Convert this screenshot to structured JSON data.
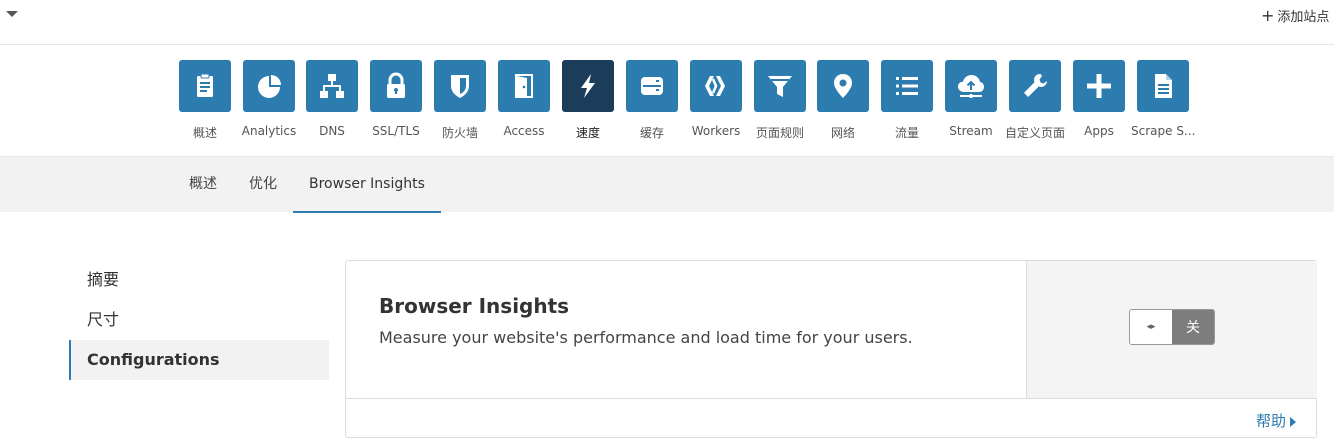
{
  "topbar": {
    "add_site_label": "添加站点"
  },
  "apps": [
    {
      "label": "概述",
      "icon": "clipboard-icon"
    },
    {
      "label": "Analytics",
      "icon": "pie-chart-icon"
    },
    {
      "label": "DNS",
      "icon": "network-icon"
    },
    {
      "label": "SSL/TLS",
      "icon": "lock-icon"
    },
    {
      "label": "防火墙",
      "icon": "shield-icon"
    },
    {
      "label": "Access",
      "icon": "door-icon"
    },
    {
      "label": "速度",
      "icon": "lightning-icon",
      "active": true
    },
    {
      "label": "缓存",
      "icon": "storage-icon"
    },
    {
      "label": "Workers",
      "icon": "workers-icon"
    },
    {
      "label": "页面规则",
      "icon": "filter-icon"
    },
    {
      "label": "网络",
      "icon": "location-pin-icon"
    },
    {
      "label": "流量",
      "icon": "list-icon"
    },
    {
      "label": "Stream",
      "icon": "cloud-upload-icon"
    },
    {
      "label": "自定义页面",
      "icon": "wrench-icon"
    },
    {
      "label": "Apps",
      "icon": "plus-icon"
    },
    {
      "label": "Scrape S...",
      "icon": "document-icon"
    }
  ],
  "subnav": {
    "tabs": [
      "概述",
      "优化",
      "Browser Insights"
    ],
    "active": "Browser Insights"
  },
  "leftmenu": {
    "items": [
      "摘要",
      "尺寸",
      "Configurations"
    ],
    "active": "Configurations"
  },
  "card": {
    "title": "Browser Insights",
    "description": "Measure your website's performance and load time for your users.",
    "toggle_state": "关",
    "toggle_knob": "◂▸",
    "help_label": "帮助"
  },
  "colors": {
    "accent": "#2c7cb0",
    "active_tile": "#1c3d5a",
    "subnav_bg": "#f2f2f2",
    "toggle_off": "#7d7d7d"
  }
}
